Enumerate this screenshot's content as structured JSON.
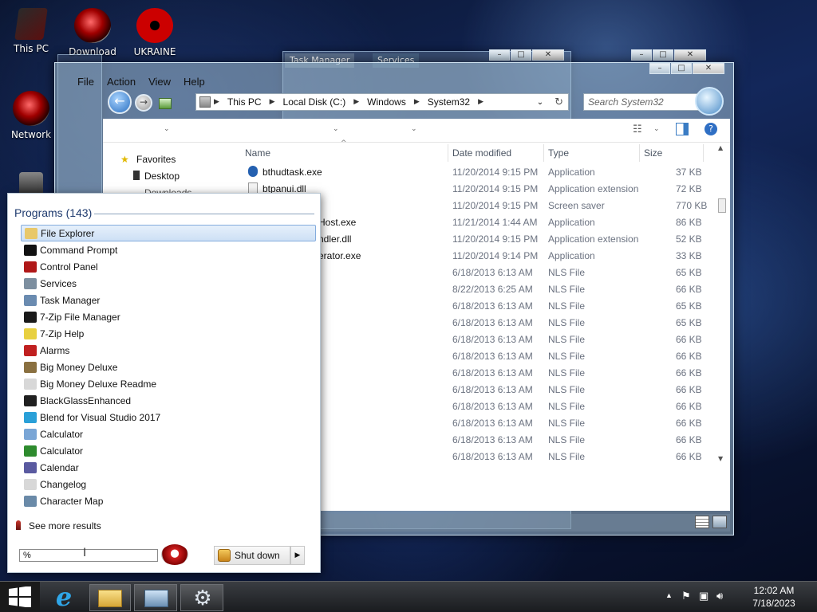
{
  "desktop": {
    "icons": [
      {
        "label": "This PC"
      },
      {
        "label": "Download"
      },
      {
        "label": "UKRAINE"
      },
      {
        "label": "Network"
      }
    ]
  },
  "ghost_windows": {
    "task_manager_title": "Task Manager",
    "services_title": "Services"
  },
  "explorer": {
    "menu": [
      "File",
      "Action",
      "View",
      "Help"
    ],
    "address": [
      "This PC",
      "Local Disk (C:)",
      "Windows",
      "System32"
    ],
    "search_placeholder": "Search System32",
    "nav": {
      "favorites": "Favorites",
      "desktop": "Desktop",
      "downloads": "Downloads"
    },
    "columns": {
      "name": "Name",
      "date": "Date modified",
      "type": "Type",
      "size": "Size"
    },
    "rows": [
      {
        "name": "bthudtask.exe",
        "date": "11/20/2014 9:15 PM",
        "type": "Application",
        "size": "37 KB"
      },
      {
        "name": "btpanui.dll",
        "date": "11/20/2014 9:15 PM",
        "type": "Application extension",
        "size": "72 KB"
      },
      {
        "name": "",
        "date": "11/20/2014 9:15 PM",
        "type": "Screen saver",
        "size": "770 KB"
      },
      {
        "name": "Host.exe",
        "date": "11/21/2014 1:44 AM",
        "type": "Application",
        "size": "86 KB"
      },
      {
        "name": "ndler.dll",
        "date": "11/20/2014 9:15 PM",
        "type": "Application extension",
        "size": "52 KB"
      },
      {
        "name": "erator.exe",
        "date": "11/20/2014 9:14 PM",
        "type": "Application",
        "size": "33 KB"
      },
      {
        "name": "",
        "date": "6/18/2013 6:13 AM",
        "type": "NLS File",
        "size": "65 KB"
      },
      {
        "name": "",
        "date": "8/22/2013 6:25 AM",
        "type": "NLS File",
        "size": "66 KB"
      },
      {
        "name": "",
        "date": "6/18/2013 6:13 AM",
        "type": "NLS File",
        "size": "65 KB"
      },
      {
        "name": "",
        "date": "6/18/2013 6:13 AM",
        "type": "NLS File",
        "size": "65 KB"
      },
      {
        "name": "",
        "date": "6/18/2013 6:13 AM",
        "type": "NLS File",
        "size": "66 KB"
      },
      {
        "name": "",
        "date": "6/18/2013 6:13 AM",
        "type": "NLS File",
        "size": "66 KB"
      },
      {
        "name": "",
        "date": "6/18/2013 6:13 AM",
        "type": "NLS File",
        "size": "66 KB"
      },
      {
        "name": "",
        "date": "6/18/2013 6:13 AM",
        "type": "NLS File",
        "size": "66 KB"
      },
      {
        "name": "",
        "date": "6/18/2013 6:13 AM",
        "type": "NLS File",
        "size": "66 KB"
      },
      {
        "name": "",
        "date": "6/18/2013 6:13 AM",
        "type": "NLS File",
        "size": "66 KB"
      },
      {
        "name": "",
        "date": "6/18/2013 6:13 AM",
        "type": "NLS File",
        "size": "66 KB"
      },
      {
        "name": "",
        "date": "6/18/2013 6:13 AM",
        "type": "NLS File",
        "size": "66 KB"
      }
    ]
  },
  "start_menu": {
    "title": "Programs (143)",
    "programs": [
      {
        "label": "File Explorer",
        "icon": "folder-icon",
        "color": "#e8c86a"
      },
      {
        "label": "Command Prompt",
        "icon": "cmd-icon",
        "color": "#111111"
      },
      {
        "label": "Control Panel",
        "icon": "control-panel-icon",
        "color": "#b01818"
      },
      {
        "label": "Services",
        "icon": "gear-icon",
        "color": "#7d8fa0"
      },
      {
        "label": "Task Manager",
        "icon": "task-manager-icon",
        "color": "#6a8bb0"
      },
      {
        "label": "7-Zip File Manager",
        "icon": "7zip-icon",
        "color": "#1a1a1a"
      },
      {
        "label": "7-Zip Help",
        "icon": "help-icon",
        "color": "#e8d040"
      },
      {
        "label": "Alarms",
        "icon": "alarm-icon",
        "color": "#c02020"
      },
      {
        "label": "Big Money Deluxe",
        "icon": "money-bag-icon",
        "color": "#8a7040"
      },
      {
        "label": "Big Money Deluxe Readme",
        "icon": "document-icon",
        "color": "#d8d8d8"
      },
      {
        "label": "BlackGlassEnhanced",
        "icon": "blackglass-icon",
        "color": "#202020"
      },
      {
        "label": "Blend for Visual Studio 2017",
        "icon": "blend-icon",
        "color": "#2aa0d8"
      },
      {
        "label": "Calculator",
        "icon": "calculator-icon",
        "color": "#7aa6d6"
      },
      {
        "label": "Calculator",
        "icon": "calculator-icon",
        "color": "#2e8b2e"
      },
      {
        "label": "Calendar",
        "icon": "calendar-icon",
        "color": "#5a5aa0"
      },
      {
        "label": "Changelog",
        "icon": "document-icon",
        "color": "#d8d8d8"
      },
      {
        "label": "Character Map",
        "icon": "character-map-icon",
        "color": "#6a8aa8"
      }
    ],
    "see_more": "See more results",
    "search_value": "%",
    "shutdown_label": "Shut down"
  },
  "tray": {
    "time": "12:02 AM",
    "date": "7/18/2023"
  }
}
